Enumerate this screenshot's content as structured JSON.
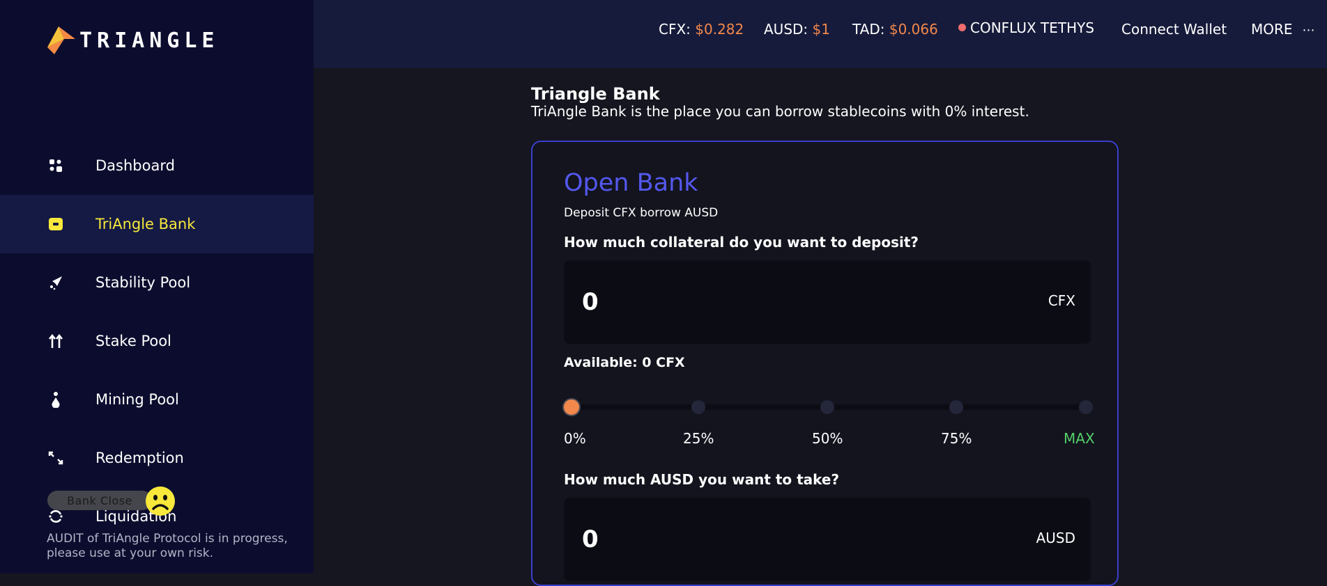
{
  "brand": {
    "name": "TRIANGLE"
  },
  "header": {
    "prices": [
      {
        "label": "CFX: ",
        "value": "$0.282"
      },
      {
        "label": "AUSD: ",
        "value": "$1"
      },
      {
        "label": "TAD: ",
        "value": "$0.066"
      }
    ],
    "network": "CONFLUX TETHYS",
    "network_status_color": "#ef6d6d",
    "connect_wallet": "Connect Wallet",
    "more": "MORE",
    "more_icon": "⋯"
  },
  "sidebar": {
    "items": [
      {
        "label": "Dashboard",
        "icon": "dashboard-icon"
      },
      {
        "label": "TriAngle Bank",
        "icon": "wallet-icon",
        "active": true
      },
      {
        "label": "Stability Pool",
        "icon": "rocket-icon"
      },
      {
        "label": "Stake Pool",
        "icon": "double-arrow-up-icon"
      },
      {
        "label": "Mining Pool",
        "icon": "user-drop-icon"
      },
      {
        "label": "Redemption",
        "icon": "arrows-in-icon"
      },
      {
        "label": "Liquidation",
        "icon": "refresh-icon"
      }
    ],
    "bank_status": "Bank Close",
    "audit_note": "AUDIT of TriAngle Protocol is in progress, please use at your own risk."
  },
  "main": {
    "title": "Triangle Bank",
    "description": "TriAngle Bank is the place you can borrow stablecoins with 0% interest.",
    "card": {
      "title": "Open Bank",
      "subtitle": "Deposit CFX borrow AUSD",
      "collateral_question": "How much collateral do you want to deposit?",
      "collateral_value": "0",
      "collateral_unit": "CFX",
      "available": "Available: 0 CFX",
      "slider_ticks": [
        "0%",
        "25%",
        "50%",
        "75%",
        "MAX"
      ],
      "slider_level": 0,
      "borrow_question": "How much AUSD you want to take?",
      "borrow_value": "0",
      "borrow_unit": "AUSD"
    }
  },
  "colors": {
    "accent_title": "#5458ee",
    "price": "#f2884b",
    "active_nav": "#f7e83b",
    "max_tick": "#55d06a"
  }
}
